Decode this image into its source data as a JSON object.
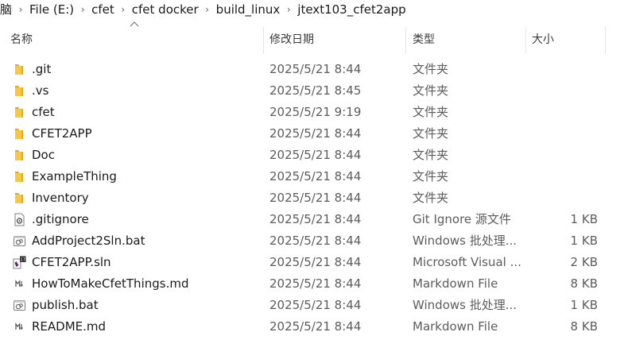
{
  "breadcrumb": [
    "脑",
    "File (E:)",
    "cfet",
    "cfet docker",
    "build_linux",
    "jtext103_cfet2app"
  ],
  "columns": {
    "name": "名称",
    "modified": "修改日期",
    "type": "类型",
    "size": "大小"
  },
  "files": [
    {
      "name": ".git",
      "date": "2025/5/21 8:44",
      "type": "文件夹",
      "size": "",
      "icon": "folder-icon"
    },
    {
      "name": ".vs",
      "date": "2025/5/21 8:45",
      "type": "文件夹",
      "size": "",
      "icon": "folder-icon"
    },
    {
      "name": "cfet",
      "date": "2025/5/21 9:19",
      "type": "文件夹",
      "size": "",
      "icon": "folder-icon"
    },
    {
      "name": "CFET2APP",
      "date": "2025/5/21 8:44",
      "type": "文件夹",
      "size": "",
      "icon": "folder-icon"
    },
    {
      "name": "Doc",
      "date": "2025/5/21 8:44",
      "type": "文件夹",
      "size": "",
      "icon": "folder-icon"
    },
    {
      "name": "ExampleThing",
      "date": "2025/5/21 8:44",
      "type": "文件夹",
      "size": "",
      "icon": "folder-icon"
    },
    {
      "name": "Inventory",
      "date": "2025/5/21 8:44",
      "type": "文件夹",
      "size": "",
      "icon": "folder-icon"
    },
    {
      "name": ".gitignore",
      "date": "2025/5/21 8:44",
      "type": "Git Ignore 源文件",
      "size": "1 KB",
      "icon": "settings-file-icon"
    },
    {
      "name": "AddProject2Sln.bat",
      "date": "2025/5/21 8:44",
      "type": "Windows 批处理...",
      "size": "1 KB",
      "icon": "batch-file-icon"
    },
    {
      "name": "CFET2APP.sln",
      "date": "2025/5/21 8:44",
      "type": "Microsoft Visual ...",
      "size": "2 KB",
      "icon": "visual-studio-solution-icon"
    },
    {
      "name": "HowToMakeCfetThings.md",
      "date": "2025/5/21 8:44",
      "type": "Markdown File",
      "size": "8 KB",
      "icon": "markdown-file-icon"
    },
    {
      "name": "publish.bat",
      "date": "2025/5/21 8:44",
      "type": "Windows 批处理...",
      "size": "1 KB",
      "icon": "batch-file-icon"
    },
    {
      "name": "README.md",
      "date": "2025/5/21 8:44",
      "type": "Markdown File",
      "size": "8 KB",
      "icon": "markdown-file-icon"
    }
  ],
  "colors": {
    "folder": "#F8C845",
    "folder_dark": "#E0A92A",
    "vs_purple": "#68217A"
  }
}
